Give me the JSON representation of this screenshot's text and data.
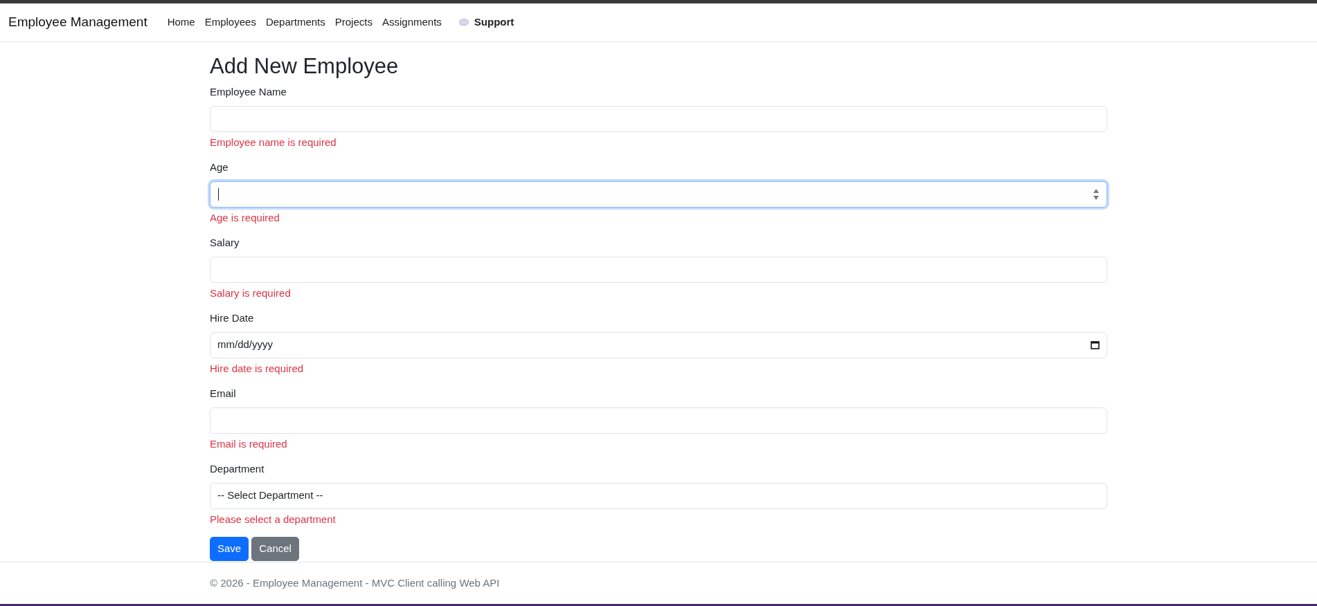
{
  "navbar": {
    "brand": "Employee Management",
    "links": [
      {
        "label": "Home",
        "kind": "plain"
      },
      {
        "label": "Employees",
        "kind": "plain"
      },
      {
        "label": "Departments",
        "kind": "plain"
      },
      {
        "label": "Projects",
        "kind": "plain"
      },
      {
        "label": "Assignments",
        "kind": "plain"
      },
      {
        "label": "Support",
        "kind": "support"
      }
    ]
  },
  "form": {
    "title": "Add New Employee",
    "fields": [
      {
        "label": "Employee Name",
        "kind": "text",
        "focused": false,
        "error": "Employee name is required"
      },
      {
        "label": "Age",
        "kind": "number",
        "focused": true,
        "error": "Age is required"
      },
      {
        "label": "Salary",
        "kind": "text",
        "focused": false,
        "error": "Salary is required"
      },
      {
        "label": "Hire Date",
        "kind": "date",
        "focused": false,
        "placeholder": "mm/dd/yyyy",
        "error": "Hire date is required"
      },
      {
        "label": "Email",
        "kind": "text",
        "focused": false,
        "error": "Email is required"
      },
      {
        "label": "Department",
        "kind": "select",
        "focused": false,
        "value": "-- Select Department --",
        "error": "Please select a department"
      }
    ],
    "buttons": [
      {
        "label": "Save",
        "kind": "primary"
      },
      {
        "label": "Cancel",
        "kind": "secondary"
      }
    ]
  },
  "footer": {
    "text": "© 2026 - Employee Management - MVC Client calling Web API"
  }
}
